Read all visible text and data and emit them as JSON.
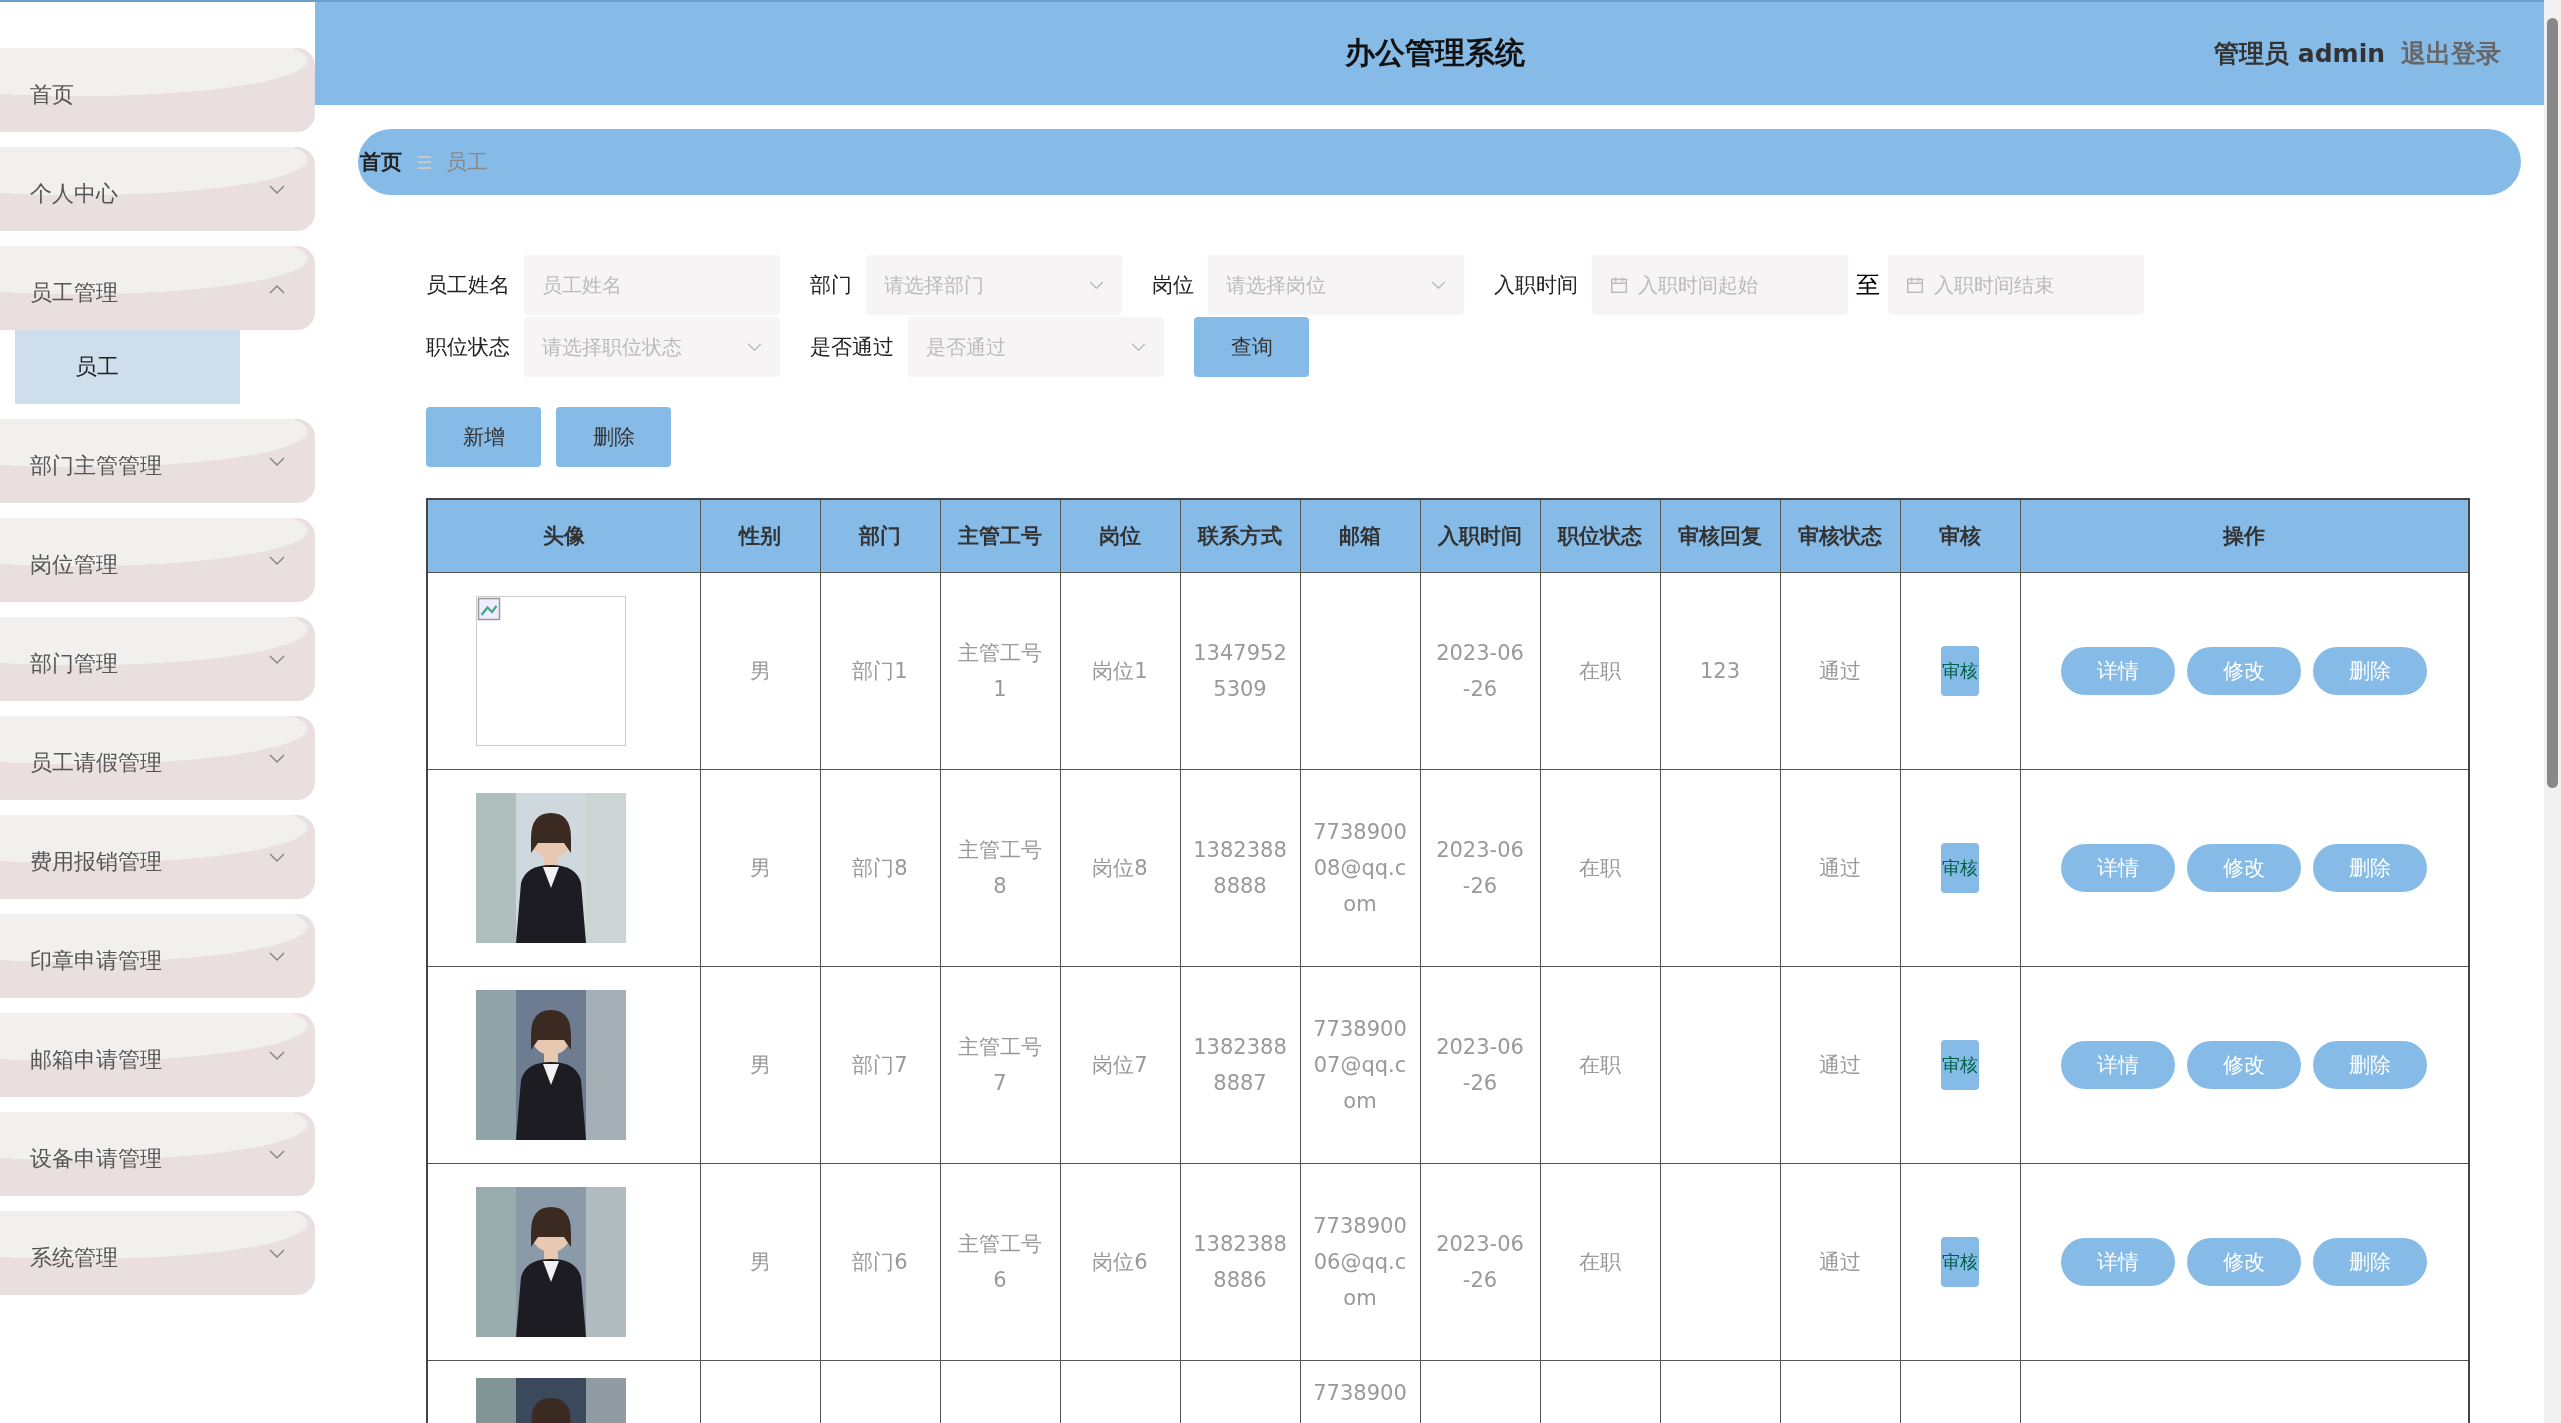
{
  "header": {
    "title": "办公管理系统",
    "user": "管理员 admin",
    "logout": "退出登录"
  },
  "sidebar": {
    "items": [
      {
        "label": "首页",
        "expandable": false
      },
      {
        "label": "个人中心",
        "expandable": true,
        "expanded": false
      },
      {
        "label": "员工管理",
        "expandable": true,
        "expanded": true,
        "children": [
          {
            "label": "员工",
            "selected": true
          }
        ]
      },
      {
        "label": "部门主管管理",
        "expandable": true,
        "expanded": false
      },
      {
        "label": "岗位管理",
        "expandable": true,
        "expanded": false
      },
      {
        "label": "部门管理",
        "expandable": true,
        "expanded": false
      },
      {
        "label": "员工请假管理",
        "expandable": true,
        "expanded": false
      },
      {
        "label": "费用报销管理",
        "expandable": true,
        "expanded": false
      },
      {
        "label": "印章申请管理",
        "expandable": true,
        "expanded": false
      },
      {
        "label": "邮箱申请管理",
        "expandable": true,
        "expanded": false
      },
      {
        "label": "设备申请管理",
        "expandable": true,
        "expanded": false
      },
      {
        "label": "系统管理",
        "expandable": true,
        "expanded": false
      }
    ]
  },
  "breadcrumb": {
    "items": [
      "首页",
      "员工"
    ],
    "separator": "☰"
  },
  "filters": {
    "rows": [
      [
        {
          "kind": "text",
          "label": "员工姓名",
          "placeholder": "员工姓名"
        },
        {
          "kind": "select",
          "label": "部门",
          "placeholder": "请选择部门"
        },
        {
          "kind": "select",
          "label": "岗位",
          "placeholder": "请选择岗位"
        },
        {
          "kind": "daterange",
          "label": "入职时间",
          "placeholder": "入职时间起始",
          "separator": "至",
          "placeholder_end": "入职时间结束"
        }
      ],
      [
        {
          "kind": "select",
          "label": "职位状态",
          "placeholder": "请选择职位状态"
        },
        {
          "kind": "select",
          "label": "是否通过",
          "placeholder": "是否通过"
        }
      ]
    ],
    "search_button": "查询"
  },
  "actions": [
    "新增",
    "删除"
  ],
  "table": {
    "columns": [
      "头像",
      "性别",
      "部门",
      "主管工号",
      "岗位",
      "联系方式",
      "邮箱",
      "入职时间",
      "职位状态",
      "审核回复",
      "审核状态",
      "审核",
      "操作"
    ],
    "rows": [
      {
        "avatar": {
          "kind": "broken"
        },
        "gender": "男",
        "department": "部门1",
        "manager_no": "主管工号1",
        "position": "岗位1",
        "phone": "13479525309",
        "hire_date": "2023-06-26",
        "job_status": "在职",
        "review_reply": "123",
        "review_status": "通过",
        "review_button": "审核",
        "buttons": [
          "详情",
          "修改",
          "删除"
        ]
      },
      {
        "avatar": {
          "kind": "picture"
        },
        "gender": "男",
        "department": "部门8",
        "manager_no": "主管工号8",
        "position": "岗位8",
        "phone": "13823888888",
        "email": "773890008@qq.com",
        "hire_date": "2023-06-26",
        "job_status": "在职",
        "review_status": "通过",
        "review_button": "审核",
        "buttons": [
          "详情",
          "修改",
          "删除"
        ]
      },
      {
        "avatar": {
          "kind": "picture"
        },
        "gender": "男",
        "department": "部门7",
        "manager_no": "主管工号7",
        "position": "岗位7",
        "phone": "13823888887",
        "email": "773890007@qq.com",
        "hire_date": "2023-06-26",
        "job_status": "在职",
        "review_status": "通过",
        "review_button": "审核",
        "buttons": [
          "详情",
          "修改",
          "删除"
        ]
      },
      {
        "avatar": {
          "kind": "picture"
        },
        "gender": "男",
        "department": "部门6",
        "manager_no": "主管工号6",
        "position": "岗位6",
        "phone": "13823888886",
        "email": "773890006@qq.com",
        "hire_date": "2023-06-26",
        "job_status": "在职",
        "review_status": "通过",
        "review_button": "审核",
        "buttons": [
          "详情",
          "修改",
          "删除"
        ]
      },
      {
        "avatar": {
          "kind": "picture"
        },
        "email": "7738900"
      }
    ]
  }
}
